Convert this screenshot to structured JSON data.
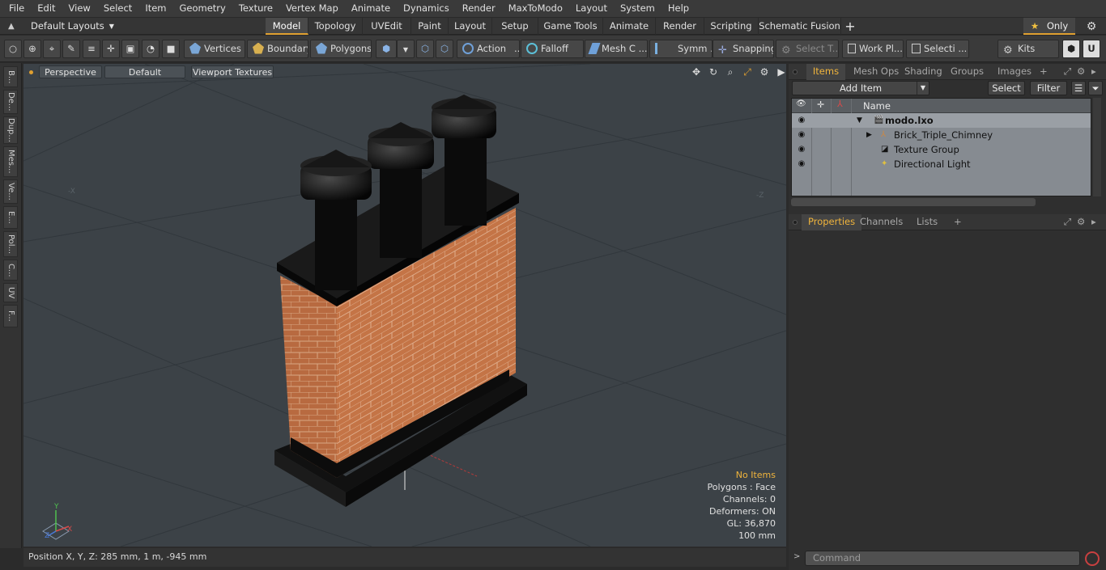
{
  "menu": [
    "File",
    "Edit",
    "View",
    "Select",
    "Item",
    "Geometry",
    "Texture",
    "Vertex Map",
    "Animate",
    "Dynamics",
    "Render",
    "MaxToModo",
    "Layout",
    "System",
    "Help"
  ],
  "layouts": {
    "label": "Default Layouts"
  },
  "tabs": [
    "Model",
    "Topology",
    "UVEdit",
    "Paint",
    "Layout",
    "Setup",
    "Game Tools",
    "Animate",
    "Render",
    "Scripting",
    "Schematic Fusion"
  ],
  "only_label": "Only",
  "toolbar": {
    "vertices": "Vertices",
    "boundary": "Boundary",
    "polygons": "Polygons",
    "action": "Action",
    "falloff": "Falloff",
    "mesh_c": "Mesh C ...",
    "symm": "Symm ...",
    "snapping": "Snapping",
    "select_t": "Select T...",
    "work_pl": "Work Pl...",
    "selecti": "Selecti ...",
    "kits": "Kits"
  },
  "left_tabs": [
    "B...",
    "De...",
    "Dup...",
    "Mes...",
    "Ve...",
    "E...",
    "Pol...",
    "C...",
    "UV",
    "F..."
  ],
  "viewport": {
    "perspective": "Perspective",
    "default": "Default",
    "textures": "Viewport Textures",
    "axis_x_left": "-X",
    "axis_z_right": "-Z",
    "stats": {
      "no_items": "No Items",
      "polygons": "Polygons : Face",
      "channels": "Channels: 0",
      "deformers": "Deformers: ON",
      "gl": "GL: 36,870",
      "scale": "100 mm"
    },
    "gizmo": {
      "y": "Y",
      "x": "X",
      "z": "Z"
    }
  },
  "status": {
    "position": "Position X, Y, Z:   285 mm, 1 m, -945 mm"
  },
  "items_panel": {
    "tabs": [
      "Items",
      "Mesh Ops",
      "Shading",
      "Groups",
      "Images"
    ],
    "add_item": "Add Item",
    "select": "Select",
    "filter": "Filter",
    "name_header": "Name",
    "rows": [
      {
        "label": "modo.lxo"
      },
      {
        "label": "Brick_Triple_Chimney"
      },
      {
        "label": "Texture Group"
      },
      {
        "label": "Directional Light"
      }
    ]
  },
  "properties_panel": {
    "tabs": [
      "Properties",
      "Channels",
      "Lists"
    ]
  },
  "command": {
    "placeholder": "Command"
  },
  "colors": {
    "accent": "#e0a030",
    "brick": "#b5643a",
    "viewport_bg": "#3c4247"
  }
}
